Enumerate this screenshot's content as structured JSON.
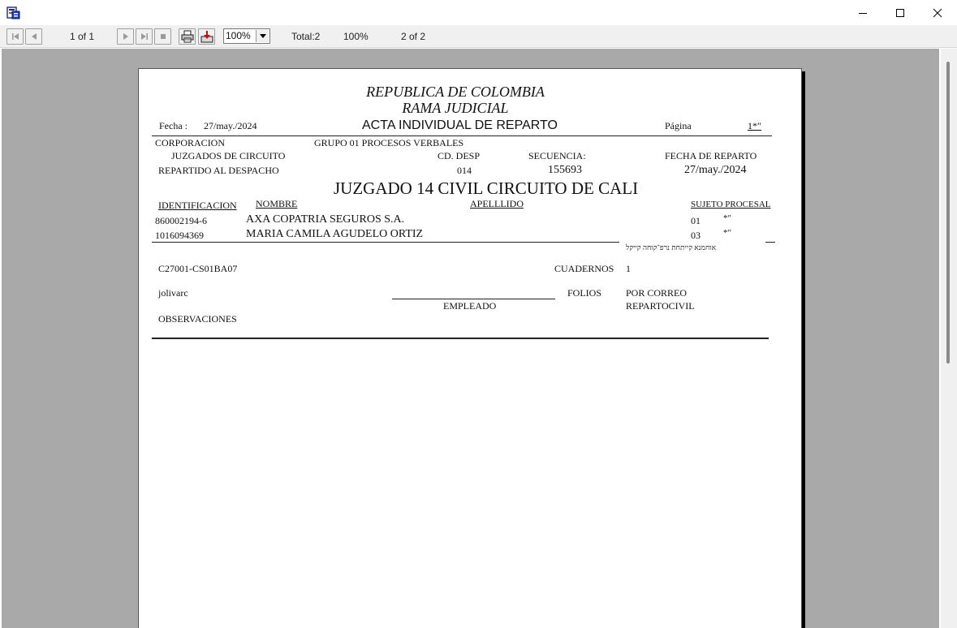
{
  "window": {
    "icons": {
      "app": "report-viewer-icon",
      "minimize": "minimize-icon",
      "maximize": "maximize-icon",
      "close": "close-icon"
    }
  },
  "toolbar": {
    "page_indicator": "1 of 1",
    "zoom_value": "100%",
    "total_label": "Total:2",
    "percent_label": "100%",
    "record_indicator": "2 of 2"
  },
  "report": {
    "header": {
      "country": "REPUBLICA DE COLOMBIA",
      "branch": "RAMA JUDICIAL",
      "title": "ACTA  INDIVIDUAL  DE  REPARTO",
      "fecha_label": "Fecha :",
      "fecha_value": "27/may./2024",
      "pagina_label": "Página",
      "pagina_value": "1*″"
    },
    "info": {
      "corporacion_label": "CORPORACION",
      "corporacion_value": "JUZGADOS DE CIRCUITO",
      "grupo": "GRUPO  01 PROCESOS VERBALES",
      "cd_desp_label": "CD. DESP",
      "cd_desp_value": "014",
      "secuencia_label": "SECUENCIA:",
      "secuencia_value": "155693",
      "fecha_reparto_label": "FECHA DE REPARTO",
      "fecha_reparto_value": "27/may./2024",
      "repartido_label": "REPARTIDO AL DESPACHO",
      "despacho": "JUZGADO 14 CIVIL CIRCUITO DE CALI"
    },
    "columns": {
      "identificacion": "IDENTIFICACION",
      "nombre": "NOMBRE",
      "apellido": "APELLLIDO",
      "sujeto": "SUJETO PROCESAL"
    },
    "parties": [
      {
        "id": "860002194-6",
        "name": "AXA COPATRIA SEGUROS S.A.",
        "sujeto": "01",
        "mark": "*″"
      },
      {
        "id": "1016094369",
        "name": "MARIA CAMILA AGUDELO ORTIZ",
        "sujeto": "03",
        "mark": "*″"
      }
    ],
    "garbled_line": "אוחמנא קייתחת נרפ־קוחה קייקל",
    "footer": {
      "code": "C27001-CS01BA07",
      "cuadernos_label": "CUADERNOS",
      "cuadernos_value": "1",
      "user": "jolivarc",
      "empleado_label": "EMPLEADO",
      "folios_label": "FOLIOS",
      "folios_value_1": "POR CORREO",
      "folios_value_2": "REPARTOCIVIL",
      "observaciones_label": "OBSERVACIONES"
    }
  },
  "colors": {
    "viewport_bg": "#a9a9a9",
    "toolbar_bg": "#f0f0f0",
    "page_bg": "#ffffff"
  }
}
